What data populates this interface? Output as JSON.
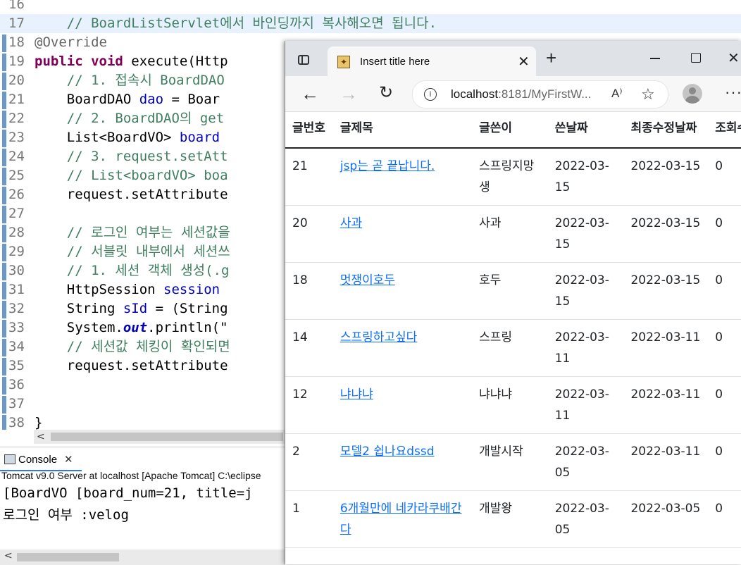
{
  "editor": {
    "lines": [
      {
        "num": "16",
        "tokens": []
      },
      {
        "num": "17",
        "tokens": [
          {
            "t": "    ",
            "c": ""
          },
          {
            "t": "// BoardListServlet에서 바인딩까지 복사해오면 됩니다.",
            "c": "cm"
          }
        ]
      },
      {
        "num": "18",
        "tokens": [
          {
            "t": "@Override",
            "c": "an"
          }
        ]
      },
      {
        "num": "19",
        "tokens": [
          {
            "t": "public",
            "c": "kw"
          },
          {
            "t": " ",
            "c": ""
          },
          {
            "t": "void",
            "c": "kw"
          },
          {
            "t": " execute(Http",
            "c": ""
          }
        ]
      },
      {
        "num": "20",
        "tokens": [
          {
            "t": "    ",
            "c": ""
          },
          {
            "t": "// 1. 접속시 BoardDAO",
            "c": "cm"
          }
        ]
      },
      {
        "num": "21",
        "tokens": [
          {
            "t": "    BoardDAO ",
            "c": ""
          },
          {
            "t": "dao",
            "c": "vr"
          },
          {
            "t": " = Boar",
            "c": ""
          }
        ]
      },
      {
        "num": "22",
        "tokens": [
          {
            "t": "    ",
            "c": ""
          },
          {
            "t": "// 2. BoardDAO의 get",
            "c": "cm"
          }
        ]
      },
      {
        "num": "23",
        "tokens": [
          {
            "t": "    List<BoardVO> ",
            "c": ""
          },
          {
            "t": "board",
            "c": "vr"
          }
        ]
      },
      {
        "num": "24",
        "tokens": [
          {
            "t": "    ",
            "c": ""
          },
          {
            "t": "// 3. request.setAtt",
            "c": "cm"
          }
        ]
      },
      {
        "num": "25",
        "tokens": [
          {
            "t": "    ",
            "c": ""
          },
          {
            "t": "// List<boardVO> boa",
            "c": "cm"
          }
        ]
      },
      {
        "num": "26",
        "tokens": [
          {
            "t": "    request.setAttribute",
            "c": ""
          }
        ]
      },
      {
        "num": "27",
        "tokens": []
      },
      {
        "num": "28",
        "tokens": [
          {
            "t": "    ",
            "c": ""
          },
          {
            "t": "// 로그인 여부는 세션값을",
            "c": "cm"
          }
        ]
      },
      {
        "num": "29",
        "tokens": [
          {
            "t": "    ",
            "c": ""
          },
          {
            "t": "// 서블릿 내부에서 세션쓰",
            "c": "cm"
          }
        ]
      },
      {
        "num": "30",
        "tokens": [
          {
            "t": "    ",
            "c": ""
          },
          {
            "t": "// 1. 세션 객체 생성(.g",
            "c": "cm"
          }
        ]
      },
      {
        "num": "31",
        "tokens": [
          {
            "t": "    HttpSession ",
            "c": ""
          },
          {
            "t": "session",
            "c": "vr"
          }
        ]
      },
      {
        "num": "32",
        "tokens": [
          {
            "t": "    String ",
            "c": ""
          },
          {
            "t": "sId",
            "c": "vr"
          },
          {
            "t": " = (String",
            "c": ""
          }
        ]
      },
      {
        "num": "33",
        "tokens": [
          {
            "t": "    System.",
            "c": ""
          },
          {
            "t": "out",
            "c": "st"
          },
          {
            "t": ".println(\"",
            "c": ""
          }
        ]
      },
      {
        "num": "34",
        "tokens": [
          {
            "t": "    ",
            "c": ""
          },
          {
            "t": "// 세션값 체킹이 확인되면",
            "c": "cm"
          }
        ]
      },
      {
        "num": "35",
        "tokens": [
          {
            "t": "    request.setAttribute",
            "c": ""
          }
        ]
      },
      {
        "num": "36",
        "tokens": []
      },
      {
        "num": "37",
        "tokens": []
      },
      {
        "num": "38",
        "tokens": [
          {
            "t": "}",
            "c": ""
          }
        ]
      }
    ],
    "scroll_left_arrow": "<"
  },
  "console": {
    "tab_label": "Console",
    "close_glyph": "✕",
    "server_line": "Tomcat v9.0 Server at localhost [Apache Tomcat] C:\\eclipse",
    "output_line1": "[BoardVO [board_num=21, title=j",
    "output_line2": "로그인 여부 :velog",
    "scroll_left_arrow": "<"
  },
  "browser": {
    "tab_title": "Insert title here",
    "tab_close_glyph": "✕",
    "new_tab_glyph": "+",
    "window_close_glyph": "✕",
    "url_host": "localhost",
    "url_rest": ":8181/MyFirstW...",
    "read_aloud_glyph": "A⁾",
    "favorite_glyph": "☆",
    "more_glyph": "···"
  },
  "board": {
    "headers": [
      "글번호",
      "글제목",
      "글쓴이",
      "쓴날짜",
      "최종수정날짜",
      "조회수"
    ],
    "rows": [
      {
        "num": "21",
        "title": "jsp는 곧 끝납니다.",
        "writer": "스프링지망생",
        "written": "2022-03-15",
        "modified": "2022-03-15",
        "views": "0"
      },
      {
        "num": "20",
        "title": "사과",
        "writer": "사과",
        "written": "2022-03-15",
        "modified": "2022-03-15",
        "views": "0"
      },
      {
        "num": "18",
        "title": "멋쟁이호두",
        "writer": "호두",
        "written": "2022-03-15",
        "modified": "2022-03-15",
        "views": "0"
      },
      {
        "num": "14",
        "title": "스프링하고싶다",
        "writer": "스프링",
        "written": "2022-03-11",
        "modified": "2022-03-11",
        "views": "0"
      },
      {
        "num": "12",
        "title": "냐냐냐",
        "writer": "냐냐냐",
        "written": "2022-03-11",
        "modified": "2022-03-11",
        "views": "0"
      },
      {
        "num": "2",
        "title": "모델2 쉽나요dssd",
        "writer": "개발시작",
        "written": "2022-03-05",
        "modified": "2022-03-11",
        "views": "0"
      },
      {
        "num": "1",
        "title": "6개월만에 네카라쿠배간다",
        "writer": "개발왕",
        "written": "2022-03-05",
        "modified": "2022-03-05",
        "views": "0"
      }
    ]
  }
}
